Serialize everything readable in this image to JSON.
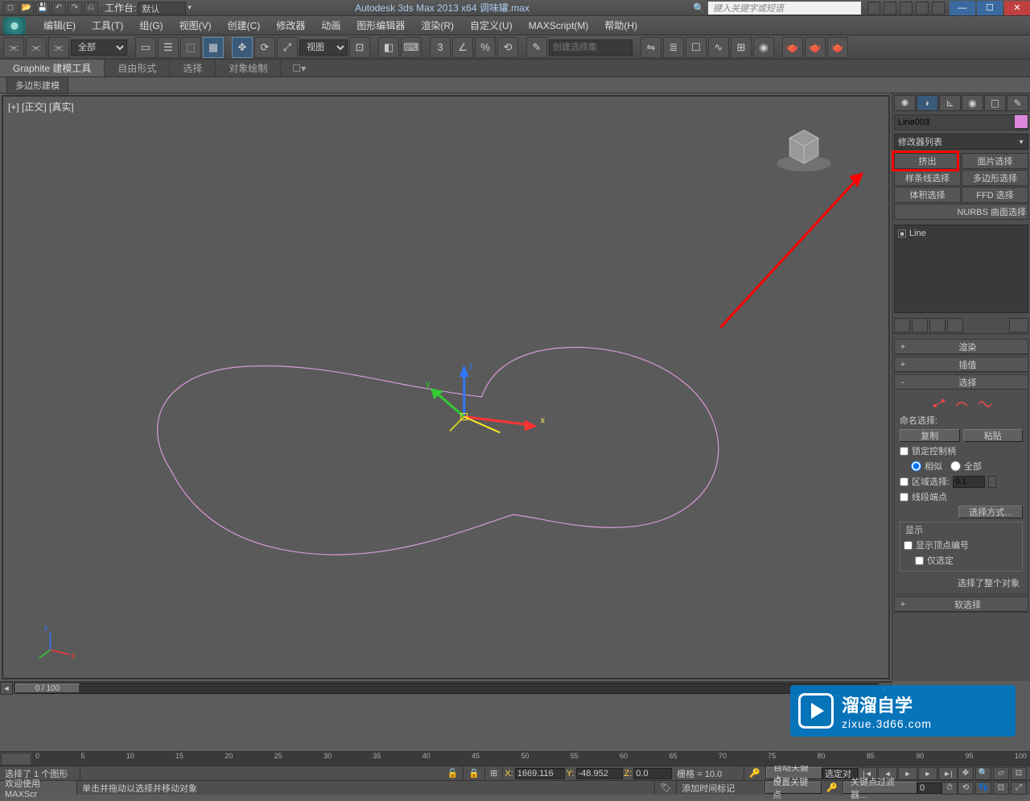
{
  "titlebar": {
    "workspace_label": "工作台:",
    "workspace_value": "默认",
    "center": "Autodesk 3ds Max  2013 x64    调味罐.max",
    "search_placeholder": "键入关键字或短语"
  },
  "menu": [
    "编辑(E)",
    "工具(T)",
    "组(G)",
    "视图(V)",
    "创建(C)",
    "修改器",
    "动画",
    "图形编辑器",
    "渲染(R)",
    "自定义(U)",
    "MAXScript(M)",
    "帮助(H)"
  ],
  "toolbar": {
    "filter": "全部",
    "view_dd": "视图",
    "selset_placeholder": "创建选择集"
  },
  "ribbon": {
    "tabs": [
      "Graphite 建模工具",
      "自由形式",
      "选择",
      "对象绘制"
    ],
    "subtab": "多边形建模"
  },
  "viewport": {
    "label": "[+] [正交] [真实]",
    "axes": {
      "x": "x",
      "y": "y",
      "z": "z"
    },
    "corner_axes": {
      "x": "x",
      "z": "z"
    }
  },
  "cmdpanel": {
    "obj_name": "Line003",
    "modlist_label": "修改器列表",
    "buttons": [
      "挤出",
      "面片选择",
      "样条线选择",
      "多边形选择",
      "体积选择",
      "FFD 选择"
    ],
    "nurbs": "NURBS 曲面选择",
    "stack_item": "Line",
    "rollouts": {
      "render": "渲染",
      "interp": "插值",
      "select": "选择",
      "softsel": "软选择"
    },
    "selection": {
      "named_sel": "命名选择:",
      "copy": "复制",
      "paste": "粘贴",
      "lock_handles": "锁定控制柄",
      "similar": "相似",
      "all": "全部",
      "area_sel": "区域选择:",
      "area_val": "0.1",
      "seg_end": "线段端点",
      "sel_mode": "选择方式...",
      "display": "显示",
      "show_vtx_num": "显示顶点编号",
      "only_sel": "仅选定",
      "msg": "选择了整个对象"
    }
  },
  "timeline": {
    "handle": "0 / 100",
    "ticks": [
      "0",
      "5",
      "10",
      "15",
      "20",
      "25",
      "30",
      "35",
      "40",
      "45",
      "50",
      "55",
      "60",
      "65",
      "70",
      "75",
      "80",
      "85",
      "90",
      "95",
      "100"
    ]
  },
  "status": {
    "line1": "选择了 1 个图形",
    "welcome": "欢迎使用  MAXScr",
    "prompt": "单击并拖动以选择并移动对象",
    "x_lbl": "X:",
    "x": "1669.116",
    "y_lbl": "Y:",
    "y": "-48.952",
    "z_lbl": "Z:",
    "z": "0.0",
    "grid": "栅格 = 10.0",
    "autokey": "自动关键点",
    "selset": "选定对",
    "setkey": "设置关键点",
    "keyfilter": "关键点过滤器...",
    "addtag": "添加时间标记"
  },
  "watermark": {
    "t1": "溜溜自学",
    "t2": "zixue.3d66.com"
  }
}
